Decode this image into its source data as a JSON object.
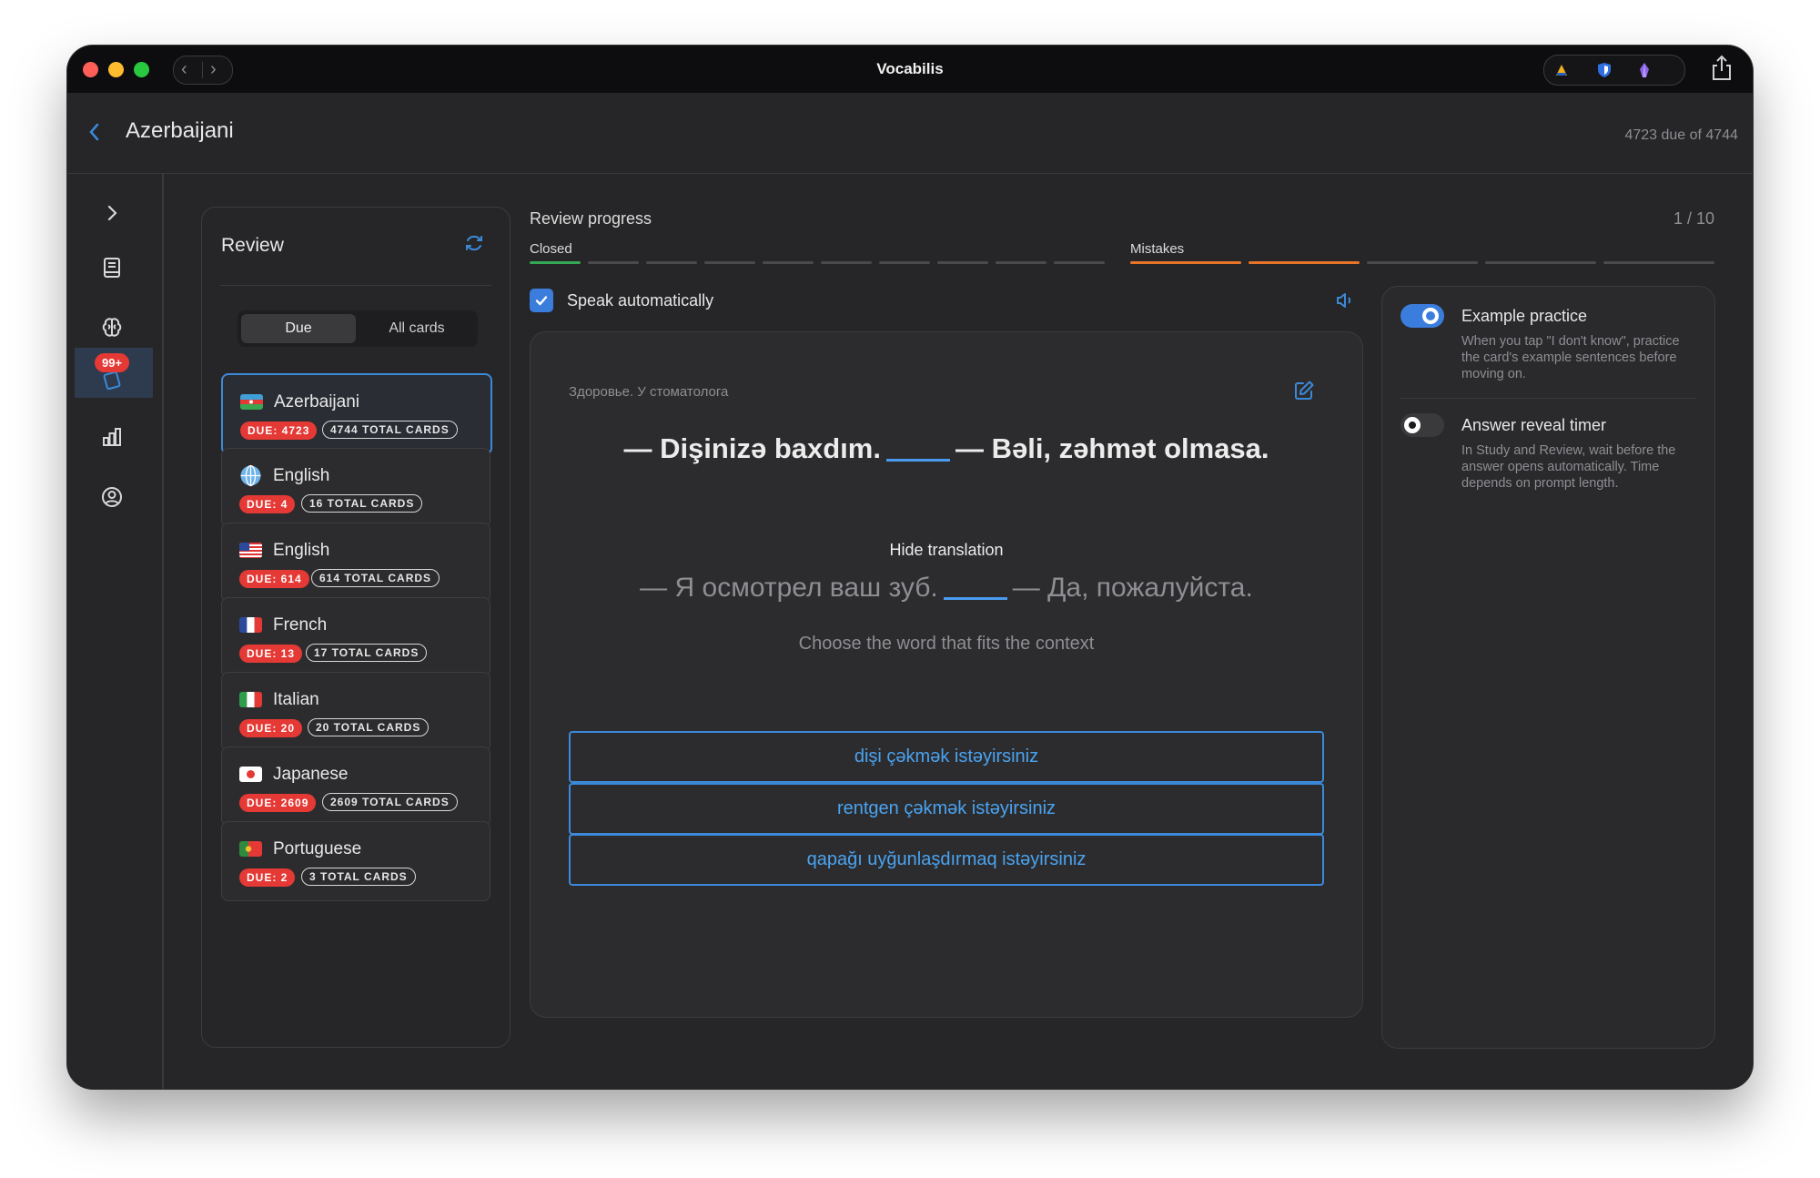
{
  "window": {
    "title": "Vocabilis"
  },
  "header": {
    "title": "Azerbaijani",
    "due_summary": "4723 due of 4744"
  },
  "sidebar": {
    "badge": "99+",
    "items": [
      {
        "icon": "chevron-right-icon"
      },
      {
        "icon": "book-icon"
      },
      {
        "icon": "brain-icon"
      },
      {
        "icon": "cards-icon"
      },
      {
        "icon": "bar-chart-icon"
      },
      {
        "icon": "user-circle-icon"
      }
    ]
  },
  "review": {
    "title": "Review",
    "tabs": {
      "due": "Due",
      "all": "All cards"
    },
    "decks": [
      {
        "name": "Azerbaijani",
        "due": "DUE: 4723",
        "total": "4744 TOTAL CARDS",
        "flag": "az"
      },
      {
        "name": "English",
        "due": "DUE: 4",
        "total": "16 TOTAL CARDS",
        "flag": "globe"
      },
      {
        "name": "English",
        "due": "DUE: 614",
        "total": "614 TOTAL CARDS",
        "flag": "us"
      },
      {
        "name": "French",
        "due": "DUE: 13",
        "total": "17 TOTAL CARDS",
        "flag": "fr"
      },
      {
        "name": "Italian",
        "due": "DUE: 20",
        "total": "20 TOTAL CARDS",
        "flag": "it"
      },
      {
        "name": "Japanese",
        "due": "DUE: 2609",
        "total": "2609 TOTAL CARDS",
        "flag": "jp"
      },
      {
        "name": "Portuguese",
        "due": "DUE: 2",
        "total": "3 TOTAL CARDS",
        "flag": "pt"
      }
    ]
  },
  "progress": {
    "label": "Review progress",
    "count": "1 / 10",
    "closed_label": "Closed",
    "mistakes_label": "Mistakes",
    "closed_segments": 10,
    "closed_done": 1,
    "mistake_segments": 5,
    "mistake_done": 2,
    "colors": {
      "closed": "#34a853",
      "mistake": "#e8742a",
      "empty": "#4a4a4c"
    }
  },
  "speak": {
    "label": "Speak automatically",
    "checked": true
  },
  "card": {
    "topic": "Здоровье. У стоматолога",
    "sentence_before": "— Dişinizə baxdım.",
    "sentence_after": "— Bəli, zəhmət olmasa.",
    "hide_translation": "Hide translation",
    "translation_before": "— Я осмотрел ваш зуб.",
    "translation_after": "— Да, пожалуйста.",
    "hint": "Choose the word that fits the context",
    "options": [
      "dişi çəkmək istəyirsiniz",
      "rentgen çəkmək istəyirsiniz",
      "qapağı uyğunlaşdırmaq istəyirsiniz"
    ]
  },
  "settings": {
    "example_practice": {
      "title": "Example practice",
      "desc": "When you tap \"I don't know\", practice the card's example sentences before moving on.",
      "on": true
    },
    "answer_timer": {
      "title": "Answer reveal timer",
      "desc": "In Study and Review, wait before the answer opens automatically. Time depends on prompt length.",
      "on": false
    }
  },
  "colors": {
    "accent": "#3b8ad9",
    "danger": "#e53935",
    "background": "#262628"
  }
}
